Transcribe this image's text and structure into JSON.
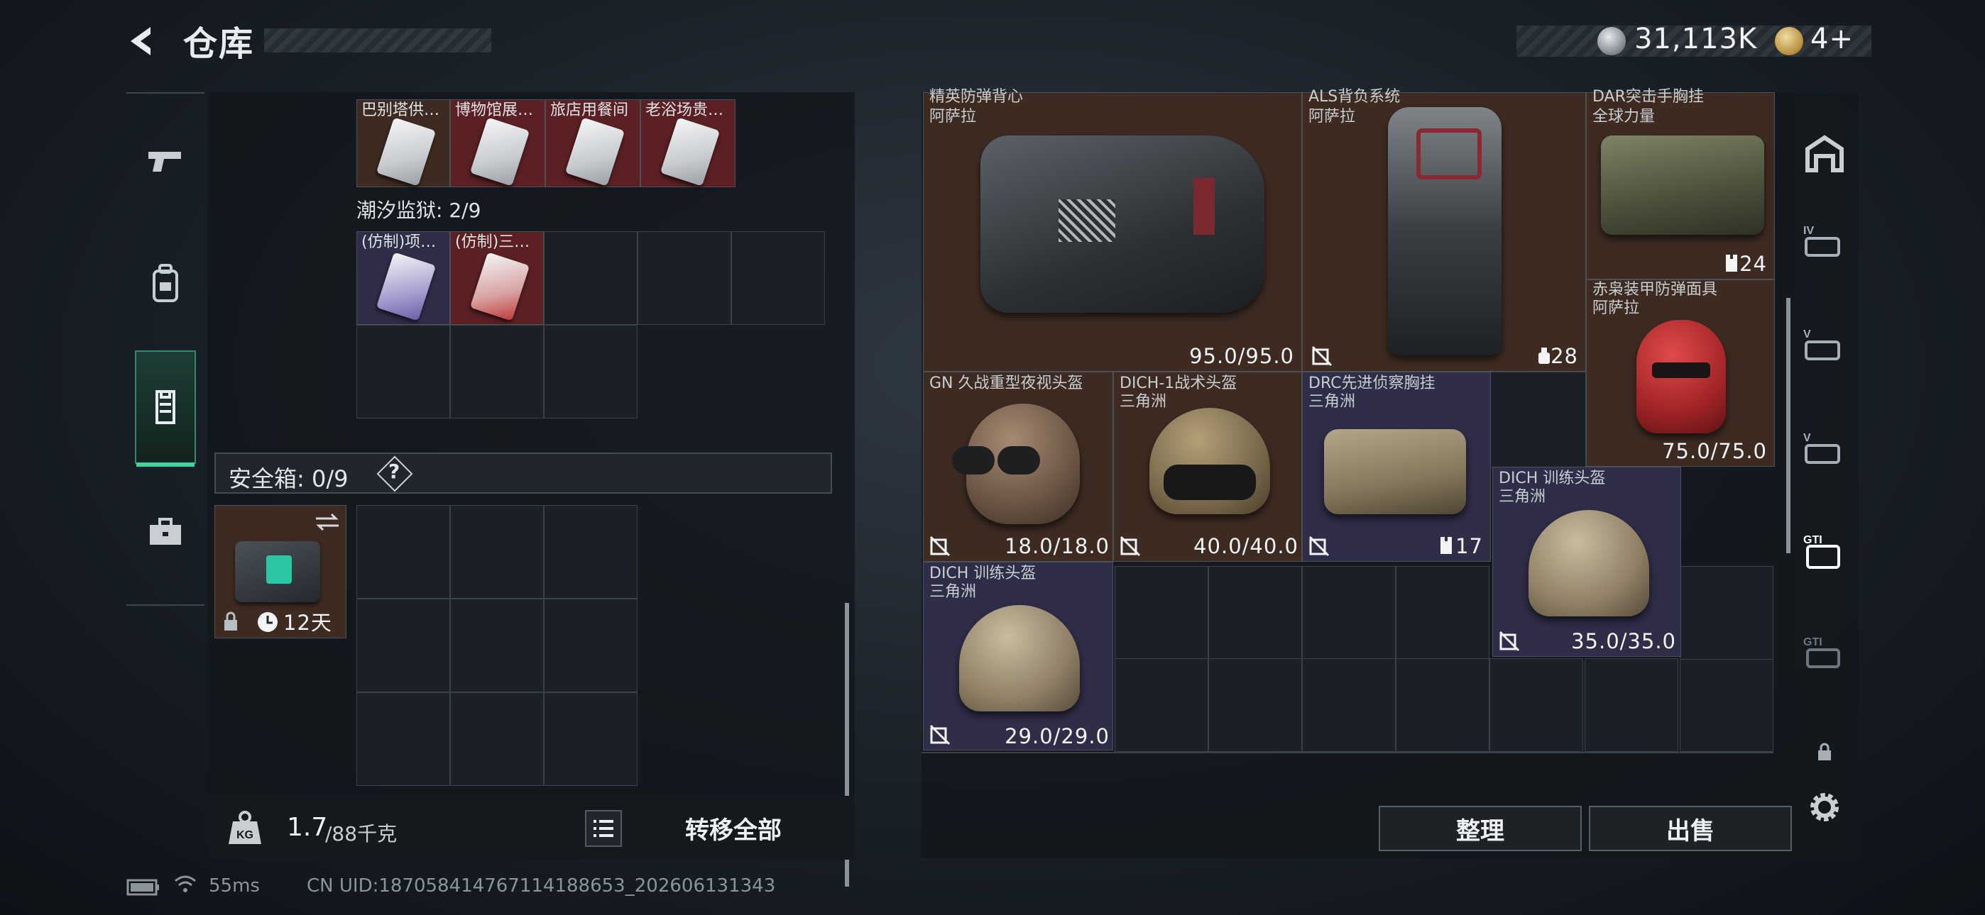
{
  "header": {
    "title": "仓库",
    "currency1": "31,113K",
    "currency2": "4+"
  },
  "left": {
    "collection_items": [
      "巴别塔供…",
      "博物馆展…",
      "旅店用餐间",
      "老浴场贵…"
    ],
    "prison_label": "潮汐监狱: 2/9",
    "prison_items": [
      "(仿制)项…",
      "(仿制)三…"
    ],
    "safebox_label": "安全箱: 0/9",
    "safebox_help": "?",
    "safebox_time": "12天",
    "weight_value": "1.7",
    "weight_unit": "/88千克",
    "transfer_all": "转移全部"
  },
  "right": {
    "items": [
      {
        "name": "精英防弹背心",
        "brand": "阿萨拉",
        "durability": "95.0/95.0"
      },
      {
        "name": "ALS背负系统",
        "brand": "阿萨拉",
        "count": "28"
      },
      {
        "name": "DAR突击手胸挂",
        "brand": "全球力量",
        "count": "24"
      },
      {
        "name": "赤枭装甲防弹面具",
        "brand": "阿萨拉",
        "durability": "75.0/75.0"
      },
      {
        "name": "GN 久战重型夜视头盔",
        "brand": "",
        "durability": "18.0/18.0"
      },
      {
        "name": "DICH-1战术头盔",
        "brand": "三角洲",
        "durability": "40.0/40.0"
      },
      {
        "name": "DRC先进侦察胸挂",
        "brand": "三角洲",
        "count": "17"
      },
      {
        "name": "DICH 训练头盔",
        "brand": "三角洲",
        "durability": "35.0/35.0"
      },
      {
        "name": "DICH 训练头盔",
        "brand": "三角洲",
        "durability": "29.0/29.0"
      }
    ],
    "organize": "整理",
    "sell": "出售"
  },
  "footer": {
    "ping": "55ms",
    "uid": "CN UID:187058414767114188653_202606131343"
  },
  "colors": {
    "accent": "#3fd39e",
    "red_cell": "#5a2024",
    "purple_cell": "#2f2d47",
    "brown_cell": "#3d2b22"
  }
}
